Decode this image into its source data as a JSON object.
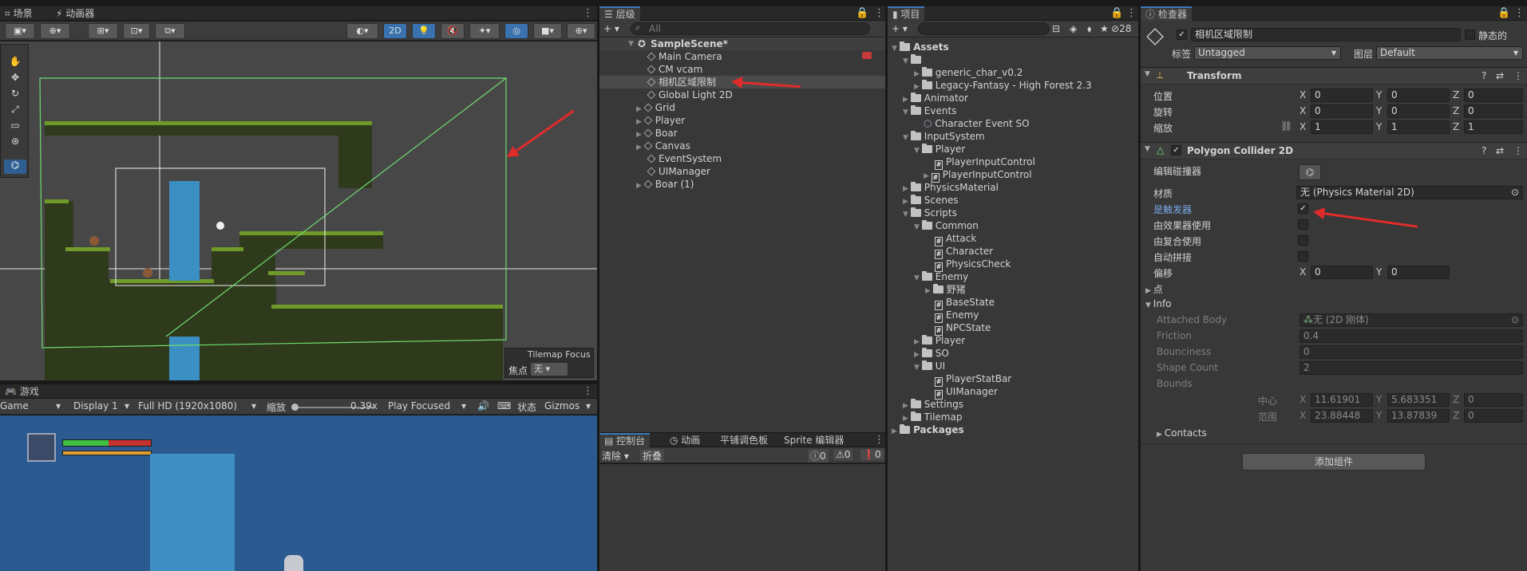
{
  "scene_tabs": {
    "scene": "场景",
    "animator": "动画器"
  },
  "scene_toolbar": {
    "mode_2d": "2D"
  },
  "tilemap_focus": {
    "title": "Tilemap Focus",
    "label": "焦点",
    "value": "无"
  },
  "game_tab": "游戏",
  "game_toolbar": {
    "mode": "Game",
    "display": "Display 1",
    "resolution": "Full HD (1920x1080)",
    "scale_label": "缩放",
    "scale_value": "0.39x",
    "play_mode": "Play Focused",
    "stats": "状态",
    "gizmos": "Gizmos"
  },
  "hierarchy": {
    "tab": "层级",
    "search_placeholder": "All",
    "scene": "SampleScene*",
    "items": [
      "Main Camera",
      "CM vcam",
      "相机区域限制",
      "Global Light 2D",
      "Grid",
      "Player",
      "Boar",
      "Canvas",
      "EventSystem",
      "UIManager",
      "Boar (1)"
    ]
  },
  "console": {
    "tabs": [
      "控制台",
      "动画",
      "平铺调色板",
      "Sprite 编辑器"
    ],
    "clear": "清除",
    "collapse": "折叠",
    "counts": [
      "0",
      "0",
      "0"
    ]
  },
  "project": {
    "tab": "项目",
    "hidden_count": "28",
    "items": [
      "Assets",
      "",
      "generic_char_v0.2",
      "Legacy-Fantasy - High Forest 2.3",
      "Animator",
      "Events",
      "Character Event SO",
      "InputSystem",
      "Player",
      "PlayerInputControl",
      "PlayerInputControl",
      "PhysicsMaterial",
      "Scenes",
      "Scripts",
      "Common",
      "Attack",
      "Character",
      "PhysicsCheck",
      "Enemy",
      "野猪",
      "BaseState",
      "Enemy",
      "NPCState",
      "Player",
      "SO",
      "UI",
      "PlayerStatBar",
      "UIManager",
      "Settings",
      "Tilemap",
      "Packages"
    ]
  },
  "inspector": {
    "tab": "检查器",
    "object_name": "相机区域限制",
    "static_label": "静态的",
    "tag_label": "标签",
    "tag_value": "Untagged",
    "layer_label": "图层",
    "layer_value": "Default",
    "transform": {
      "title": "Transform",
      "rows": [
        {
          "label": "位置",
          "x": "0",
          "y": "0",
          "z": "0"
        },
        {
          "label": "旋转",
          "x": "0",
          "y": "0",
          "z": "0"
        },
        {
          "label": "缩放",
          "x": "1",
          "y": "1",
          "z": "1"
        }
      ]
    },
    "collider": {
      "title": "Polygon Collider 2D",
      "edit_label": "编辑碰撞器",
      "material_label": "材质",
      "material_value": "无 (Physics Material 2D)",
      "trigger_label": "是触发器",
      "effector_label": "由效果器使用",
      "composite_label": "由复合使用",
      "autotile_label": "自动拼接",
      "offset_label": "偏移",
      "offset_x": "0",
      "offset_y": "0",
      "points_label": "点",
      "info_label": "Info",
      "attached_body_label": "Attached Body",
      "attached_body_value": "无 (2D 刚体)",
      "friction_label": "Friction",
      "friction_value": "0.4",
      "bounciness_label": "Bounciness",
      "bounciness_value": "0",
      "shape_count_label": "Shape Count",
      "shape_count_value": "2",
      "bounds_label": "Bounds",
      "center_label": "中心",
      "center_x": "11.61901",
      "center_y": "5.683351",
      "center_z": "0",
      "extent_label": "范围",
      "extent_x": "23.88448",
      "extent_y": "13.87839",
      "extent_z": "0",
      "contacts_label": "Contacts"
    },
    "add_component": "添加组件"
  },
  "axis_letters": {
    "x": "X",
    "y": "Y",
    "z": "Z"
  },
  "colors": {
    "accent_blue": "#3a79bb",
    "collider_green": "#6fdc6f",
    "annotation_red": "#e02b2b"
  }
}
